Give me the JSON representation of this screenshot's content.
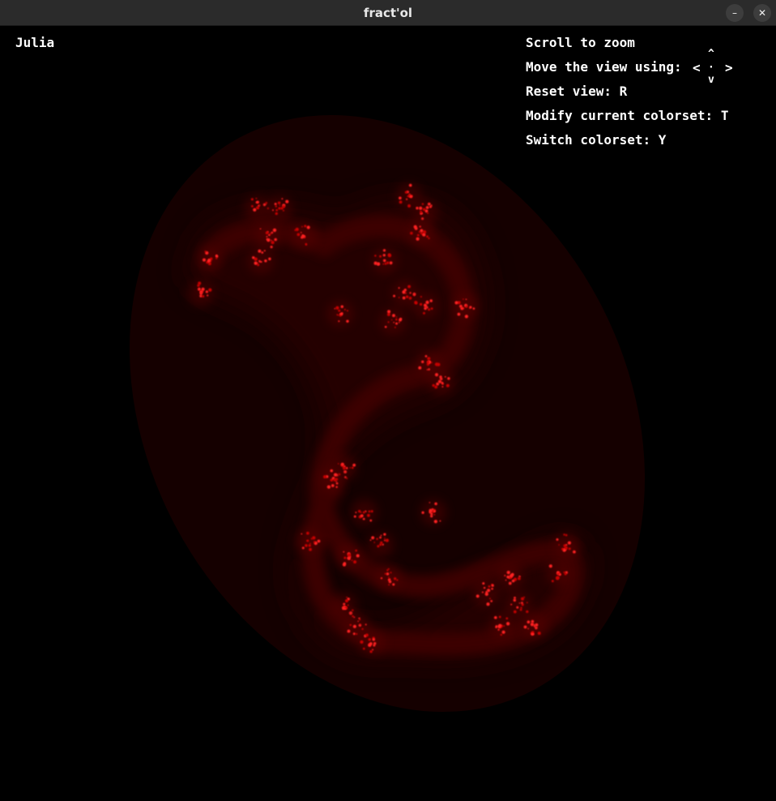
{
  "window": {
    "title": "fract'ol",
    "minimize_symbol": "–",
    "close_symbol": "✕"
  },
  "overlay": {
    "fractal_name": "Julia",
    "help": {
      "zoom": "Scroll to zoom",
      "move": "Move the view using:",
      "reset": "Reset view: R",
      "modify_colorset": "Modify current colorset: T",
      "switch_colorset": "Switch colorset: Y"
    },
    "arrows": {
      "up": "^",
      "left": "<",
      "center": "·",
      "right": ">",
      "down": "v"
    }
  },
  "colors": {
    "background": "#000000",
    "fractal_glow": "#2a0000",
    "fractal_core": "#ff1a1a"
  }
}
